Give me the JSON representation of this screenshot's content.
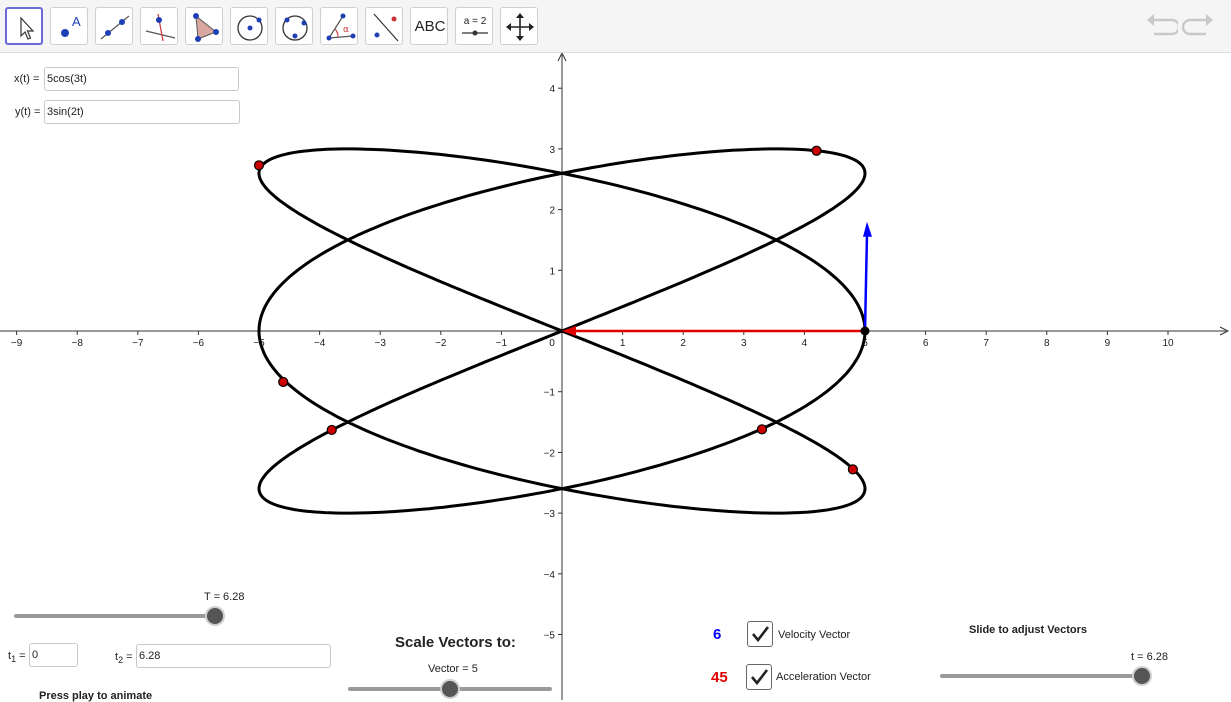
{
  "toolbar": {
    "tools": [
      {
        "name": "move-tool",
        "icon": "arrow-cursor-icon",
        "active": true
      },
      {
        "name": "point-tool",
        "icon": "point-icon",
        "label": "A"
      },
      {
        "name": "line-tool",
        "icon": "line-through-points-icon"
      },
      {
        "name": "perpendicular-line-tool",
        "icon": "perpendicular-line-icon"
      },
      {
        "name": "polygon-tool",
        "icon": "polygon-icon"
      },
      {
        "name": "circle-center-point-tool",
        "icon": "circle-center-point-icon"
      },
      {
        "name": "circle-three-points-tool",
        "icon": "circle-three-points-icon"
      },
      {
        "name": "angle-tool",
        "icon": "angle-icon",
        "label": "α"
      },
      {
        "name": "reflect-tool",
        "icon": "reflect-about-line-icon"
      },
      {
        "name": "text-tool",
        "icon": "text-icon",
        "label": "ABC"
      },
      {
        "name": "slider-tool",
        "icon": "slider-icon",
        "label": "a = 2"
      },
      {
        "name": "move-graphics-view-tool",
        "icon": "move-view-icon"
      }
    ],
    "undo_icon": "undo-icon",
    "redo_icon": "redo-icon"
  },
  "inputs": {
    "x_label": "x(t) =",
    "x_value": "5cos(3t)",
    "y_label": "y(t) =",
    "y_value": "3sin(2t)",
    "t1_label": "t",
    "t1_sub": "1",
    "t1_eq": "=",
    "t1_value": "0",
    "t2_label": "t",
    "t2_sub": "2",
    "t2_eq": "=",
    "t2_value": "6.28"
  },
  "sliders": {
    "T": {
      "label": "T = 6.28",
      "value": 6.28,
      "min": 0,
      "max": 6.28
    },
    "vector": {
      "label": "Vector = 5",
      "value": 5,
      "min": 0,
      "max": 10
    },
    "t": {
      "label": "t = 6.28",
      "value": 6.28,
      "min": 0,
      "max": 6.28
    }
  },
  "text": {
    "scale_vectors": "Scale Vectors to:",
    "slide_adjust": "Slide to adjust Vectors",
    "press_play": "Press play to animate"
  },
  "vectors": {
    "velocity_value": "6",
    "velocity_label": "Velocity Vector",
    "velocity_checked": true,
    "velocity_color": "#0000ff",
    "acceleration_value": "45",
    "acceleration_label": "Acceleration Vector",
    "acceleration_checked": true,
    "acceleration_color": "#e00000"
  },
  "graph": {
    "x_ticks": [
      -9,
      -8,
      -7,
      -6,
      -5,
      -4,
      -3,
      -2,
      -1,
      0,
      1,
      2,
      3,
      4,
      5,
      6,
      7,
      8,
      9,
      10
    ],
    "y_ticks": [
      4,
      3,
      2,
      1,
      -1,
      -2,
      -3,
      -4,
      -5
    ],
    "x_tick_labels": [
      "−9",
      "−8",
      "−7",
      "−6",
      "−5",
      "−4",
      "−3",
      "−2",
      "−1",
      "0",
      "1",
      "2",
      "3",
      "4",
      "5",
      "6",
      "7",
      "8",
      "9",
      "10"
    ],
    "y_tick_labels": [
      "4",
      "3",
      "2",
      "1",
      "−1",
      "−2",
      "−3",
      "−4",
      "−5"
    ],
    "curve": {
      "x_expr": "5cos(3t)",
      "y_expr": "3sin(2t)",
      "t_min": 0,
      "t_max": 6.28,
      "color": "#000000"
    },
    "red_points": [
      [
        4.2,
        2.97
      ],
      [
        -5.0,
        2.73
      ],
      [
        -4.6,
        -0.84
      ],
      [
        -3.8,
        -1.63
      ],
      [
        3.3,
        -1.62
      ],
      [
        4.8,
        -2.28
      ]
    ],
    "current_point": [
      5,
      0
    ],
    "velocity_end": [
      5.0,
      1.8
    ],
    "acceleration_end": [
      0,
      0
    ],
    "point_color": "#cc0000",
    "velocity_color": "#0000ff",
    "acceleration_color": "#e00000"
  }
}
